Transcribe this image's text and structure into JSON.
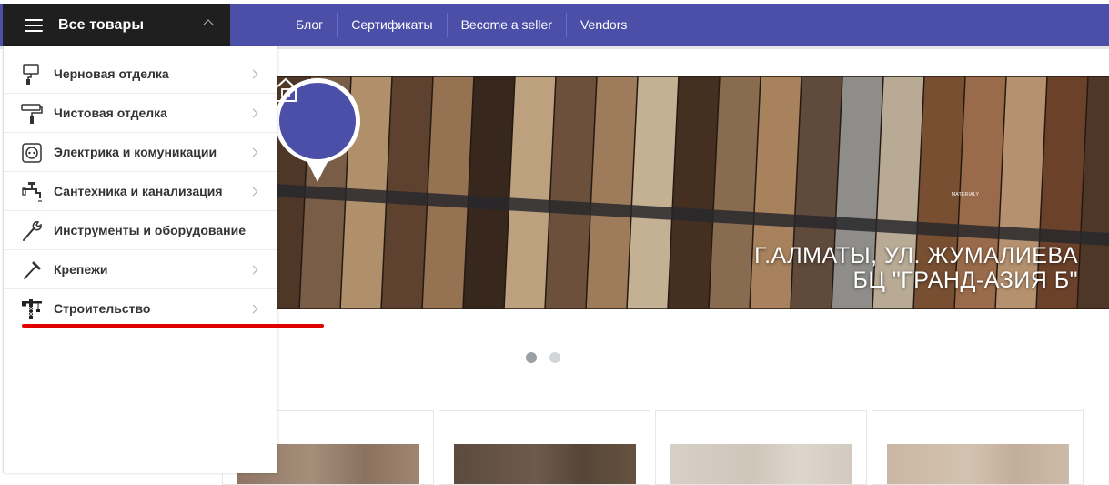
{
  "header": {
    "all_products_label": "Все товары",
    "nav": [
      "Блог",
      "Сертификаты",
      "Become a seller",
      "Vendors"
    ]
  },
  "menu": {
    "items": [
      {
        "label": "Черновая отделка",
        "icon": "paint-roller-icon"
      },
      {
        "label": "Чистовая отделка",
        "icon": "roller-brush-icon"
      },
      {
        "label": "Электрика и комуникации",
        "icon": "power-socket-icon"
      },
      {
        "label": "Сантехника и канализация",
        "icon": "faucet-icon"
      },
      {
        "label": "Инструменты и оборудование",
        "icon": "wrench-icon"
      },
      {
        "label": "Крепежи",
        "icon": "nail-icon"
      },
      {
        "label": "Строительство",
        "icon": "crane-icon"
      }
    ]
  },
  "banner": {
    "address_line1": "Г.АЛМАТЫ, УЛ. ЖУМАЛИЕВА",
    "address_line2": "БЦ \"ГРАНД-АЗИЯ Б\"",
    "logo_subtitle": "MATERIALY",
    "slide_index": 1,
    "slide_count": 2
  },
  "colors": {
    "topbar": "#4b4fa8",
    "category_button": "#1f1f1f",
    "highlight_underline": "#e00000"
  }
}
